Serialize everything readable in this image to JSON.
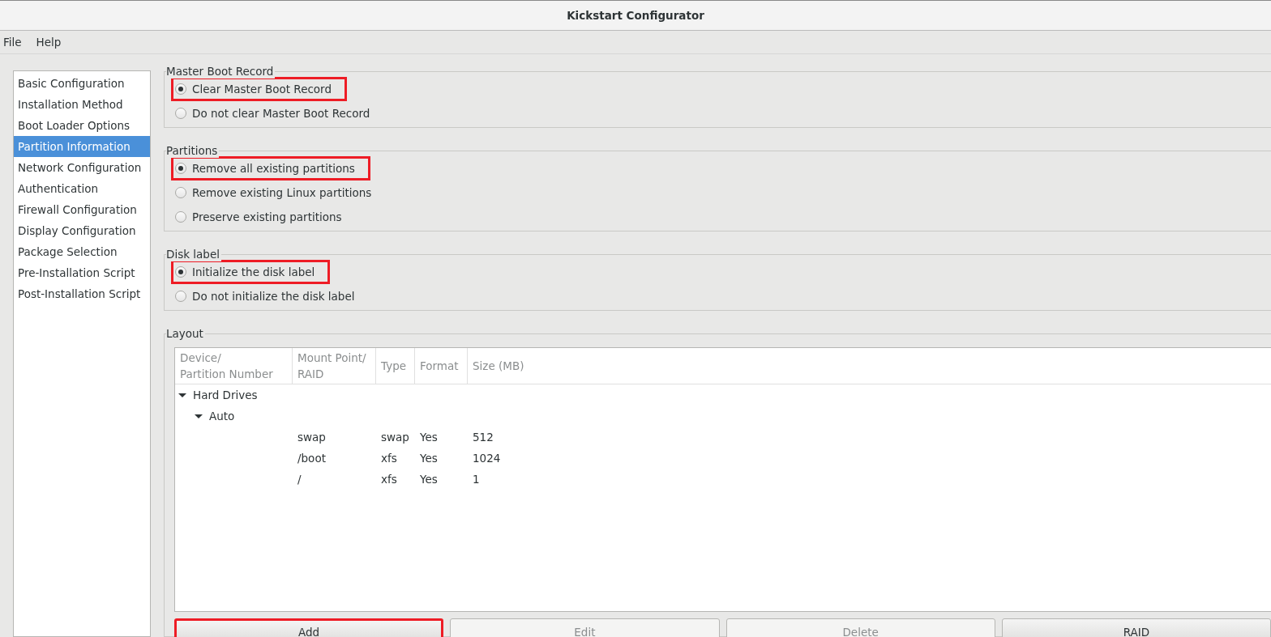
{
  "window": {
    "title": "Kickstart Configurator"
  },
  "menu": [
    "File",
    "Help"
  ],
  "sidebar": {
    "items": [
      {
        "label": "Basic Configuration",
        "selected": false
      },
      {
        "label": "Installation Method",
        "selected": false
      },
      {
        "label": "Boot Loader Options",
        "selected": false
      },
      {
        "label": "Partition Information",
        "selected": true
      },
      {
        "label": "Network Configuration",
        "selected": false
      },
      {
        "label": "Authentication",
        "selected": false
      },
      {
        "label": "Firewall Configuration",
        "selected": false
      },
      {
        "label": "Display Configuration",
        "selected": false
      },
      {
        "label": "Package Selection",
        "selected": false
      },
      {
        "label": "Pre-Installation Script",
        "selected": false
      },
      {
        "label": "Post-Installation Script",
        "selected": false
      }
    ]
  },
  "groups": [
    {
      "title": "Master Boot Record",
      "options": [
        {
          "label": "Clear Master Boot Record",
          "selected": true,
          "highlighted": true
        },
        {
          "label": "Do not clear Master Boot Record",
          "selected": false,
          "highlighted": false
        }
      ]
    },
    {
      "title": "Partitions",
      "options": [
        {
          "label": "Remove all existing partitions",
          "selected": true,
          "highlighted": true
        },
        {
          "label": "Remove existing Linux partitions",
          "selected": false,
          "highlighted": false
        },
        {
          "label": "Preserve existing partitions",
          "selected": false,
          "highlighted": false
        }
      ]
    },
    {
      "title": "Disk label",
      "options": [
        {
          "label": "Initialize the disk label",
          "selected": true,
          "highlighted": true
        },
        {
          "label": "Do not initialize the disk label",
          "selected": false,
          "highlighted": false
        }
      ]
    }
  ],
  "layout": {
    "title": "Layout",
    "columns": [
      "Device/\nPartition Number",
      "Mount Point/\nRAID",
      "Type",
      "Format",
      "Size (MB)"
    ],
    "rows": [
      {
        "device": "Hard Drives",
        "expanded": true,
        "children": [
          {
            "device": "Auto",
            "expanded": true,
            "children": [
              {
                "mount": "swap",
                "type": "swap",
                "format": "Yes",
                "size": "512"
              },
              {
                "mount": "/boot",
                "type": "xfs",
                "format": "Yes",
                "size": "1024"
              },
              {
                "mount": "/",
                "type": "xfs",
                "format": "Yes",
                "size": "1"
              }
            ]
          }
        ]
      }
    ],
    "buttons": [
      {
        "label": "Add",
        "disabled": false,
        "highlighted": true
      },
      {
        "label": "Edit",
        "disabled": true,
        "highlighted": false
      },
      {
        "label": "Delete",
        "disabled": true,
        "highlighted": false
      },
      {
        "label": "RAID",
        "disabled": false,
        "highlighted": false
      }
    ]
  }
}
